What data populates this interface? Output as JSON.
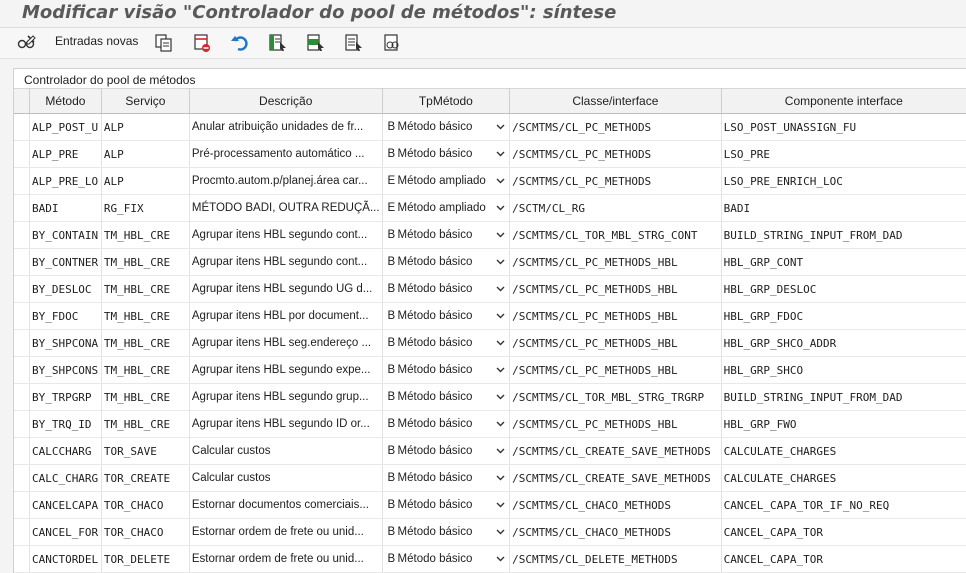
{
  "title": "Modificar visão \"Controlador do pool de métodos\": síntese",
  "toolbar": {
    "new_entries_label": "Entradas novas"
  },
  "panel_title": "Controlador do pool de métodos",
  "columns": {
    "metodo": "Método",
    "servico": "Serviço",
    "descricao": "Descrição",
    "tpmetodo": "TpMétodo",
    "classe": "Classe/interface",
    "componente": "Componente interface"
  },
  "rows": [
    {
      "metodo": "ALP_POST_U",
      "servico": "ALP",
      "descricao": "Anular atribuição unidades de fr...",
      "tp_code": "B",
      "tp_label": "Método básico",
      "classe": "/SCMTMS/CL_PC_METHODS",
      "componente": "LSO_POST_UNASSIGN_FU"
    },
    {
      "metodo": "ALP_PRE",
      "servico": "ALP",
      "descricao": "Pré-processamento automático ...",
      "tp_code": "B",
      "tp_label": "Método básico",
      "classe": "/SCMTMS/CL_PC_METHODS",
      "componente": "LSO_PRE"
    },
    {
      "metodo": "ALP_PRE_LO",
      "servico": "ALP",
      "descricao": "Procmto.autom.p/planej.área car...",
      "tp_code": "E",
      "tp_label": "Método ampliado",
      "classe": "/SCMTMS/CL_PC_METHODS",
      "componente": "LSO_PRE_ENRICH_LOC"
    },
    {
      "metodo": "BADI",
      "servico": "RG_FIX",
      "descricao": "MÉTODO BADI, OUTRA REDUÇÃ...",
      "tp_code": "E",
      "tp_label": "Método ampliado",
      "classe": "/SCTM/CL_RG",
      "componente": "BADI"
    },
    {
      "metodo": "BY_CONTAIN",
      "servico": "TM_HBL_CRE",
      "descricao": "Agrupar itens HBL segundo cont...",
      "tp_code": "B",
      "tp_label": "Método básico",
      "classe": "/SCMTMS/CL_TOR_MBL_STRG_CONT",
      "componente": "BUILD_STRING_INPUT_FROM_DAD"
    },
    {
      "metodo": "BY_CONTNER",
      "servico": "TM_HBL_CRE",
      "descricao": "Agrupar itens HBL segundo cont...",
      "tp_code": "B",
      "tp_label": "Método básico",
      "classe": "/SCMTMS/CL_PC_METHODS_HBL",
      "componente": "HBL_GRP_CONT"
    },
    {
      "metodo": "BY_DESLOC",
      "servico": "TM_HBL_CRE",
      "descricao": "Agrupar itens HBL segundo UG d...",
      "tp_code": "B",
      "tp_label": "Método básico",
      "classe": "/SCMTMS/CL_PC_METHODS_HBL",
      "componente": "HBL_GRP_DESLOC"
    },
    {
      "metodo": "BY_FDOC",
      "servico": "TM_HBL_CRE",
      "descricao": "Agrupar itens HBL por document...",
      "tp_code": "B",
      "tp_label": "Método básico",
      "classe": "/SCMTMS/CL_PC_METHODS_HBL",
      "componente": "HBL_GRP_FDOC"
    },
    {
      "metodo": "BY_SHPCONA",
      "servico": "TM_HBL_CRE",
      "descricao": "Agrupar itens HBL seg.endereço ...",
      "tp_code": "B",
      "tp_label": "Método básico",
      "classe": "/SCMTMS/CL_PC_METHODS_HBL",
      "componente": "HBL_GRP_SHCO_ADDR"
    },
    {
      "metodo": "BY_SHPCONS",
      "servico": "TM_HBL_CRE",
      "descricao": "Agrupar itens HBL segundo expe...",
      "tp_code": "B",
      "tp_label": "Método básico",
      "classe": "/SCMTMS/CL_PC_METHODS_HBL",
      "componente": "HBL_GRP_SHCO"
    },
    {
      "metodo": "BY_TRPGRP",
      "servico": "TM_HBL_CRE",
      "descricao": "Agrupar itens HBL segundo grup...",
      "tp_code": "B",
      "tp_label": "Método básico",
      "classe": "/SCMTMS/CL_TOR_MBL_STRG_TRGRP",
      "componente": "BUILD_STRING_INPUT_FROM_DAD"
    },
    {
      "metodo": "BY_TRQ_ID",
      "servico": "TM_HBL_CRE",
      "descricao": "Agrupar itens HBL segundo ID or...",
      "tp_code": "B",
      "tp_label": "Método básico",
      "classe": "/SCMTMS/CL_PC_METHODS_HBL",
      "componente": "HBL_GRP_FWO"
    },
    {
      "metodo": "CALCCHARG",
      "servico": "TOR_SAVE",
      "descricao": "Calcular custos",
      "tp_code": "B",
      "tp_label": "Método básico",
      "classe": "/SCMTMS/CL_CREATE_SAVE_METHODS",
      "componente": "CALCULATE_CHARGES"
    },
    {
      "metodo": "CALC_CHARG",
      "servico": "TOR_CREATE",
      "descricao": "Calcular custos",
      "tp_code": "B",
      "tp_label": "Método básico",
      "classe": "/SCMTMS/CL_CREATE_SAVE_METHODS",
      "componente": "CALCULATE_CHARGES"
    },
    {
      "metodo": "CANCELCAPA",
      "servico": "TOR_CHACO",
      "descricao": "Estornar documentos comerciais...",
      "tp_code": "B",
      "tp_label": "Método básico",
      "classe": "/SCMTMS/CL_CHACO_METHODS",
      "componente": "CANCEL_CAPA_TOR_IF_NO_REQ"
    },
    {
      "metodo": "CANCEL_FOR",
      "servico": "TOR_CHACO",
      "descricao": "Estornar ordem de frete ou unid...",
      "tp_code": "B",
      "tp_label": "Método básico",
      "classe": "/SCMTMS/CL_CHACO_METHODS",
      "componente": "CANCEL_CAPA_TOR"
    },
    {
      "metodo": "CANCTORDEL",
      "servico": "TOR_DELETE",
      "descricao": "Estornar ordem de frete ou unid...",
      "tp_code": "B",
      "tp_label": "Método básico",
      "classe": "/SCMTMS/CL_DELETE_METHODS",
      "componente": "CANCEL_CAPA_TOR"
    }
  ],
  "icons": {
    "display_change": "glasses-pencil-icon",
    "copy": "copy-icon",
    "delete": "delete-icon",
    "undo": "undo-icon",
    "select_all": "select-all-icon",
    "select_block": "select-block-icon",
    "deselect_all": "deselect-all-icon",
    "config": "config-icon",
    "dropdown": "chevron-down-icon"
  },
  "colors": {
    "title": "#595959",
    "undo_blue": "#1f77c8",
    "delete_red": "#d9232d",
    "select_green": "#2e8b3a"
  }
}
